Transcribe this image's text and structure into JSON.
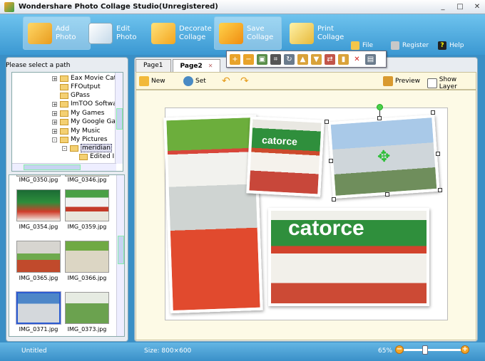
{
  "window": {
    "title": "Wondershare Photo Collage Studio(Unregistered)",
    "min": "_",
    "max": "□",
    "close": "✕"
  },
  "toolbar": {
    "add_photo": "Add Photo",
    "edit_photo": "Edit Photo",
    "decorate_collage": "Decorate Collage",
    "save_collage": "Save Collage",
    "print_collage": "Print Collage",
    "file": "File",
    "register": "Register",
    "help": "Help"
  },
  "left": {
    "path_label": "Please select a path",
    "tree": [
      {
        "label": "Eax Movie Catalog",
        "pm": "+"
      },
      {
        "label": "FFOutput",
        "pm": ""
      },
      {
        "label": "GPass",
        "pm": ""
      },
      {
        "label": "ImTOO Software",
        "pm": "+"
      },
      {
        "label": "My Games",
        "pm": "+"
      },
      {
        "label": "My Google Gadgets",
        "pm": "+"
      },
      {
        "label": "My Music",
        "pm": "+"
      },
      {
        "label": "My Pictures",
        "pm": "-"
      },
      {
        "label": "meridian",
        "pm": "-"
      },
      {
        "label": "Edited Im",
        "pm": ""
      }
    ],
    "thumbs": [
      {
        "caption": "IMG_0350.jpg"
      },
      {
        "caption": "IMG_0346.jpg"
      },
      {
        "caption": "IMG_0354.jpg"
      },
      {
        "caption": "IMG_0359.jpg"
      },
      {
        "caption": "IMG_0365.jpg"
      },
      {
        "caption": "IMG_0366.jpg"
      },
      {
        "caption": "IMG_0371.jpg"
      },
      {
        "caption": "IMG_0373.jpg"
      }
    ]
  },
  "tabs": {
    "page1": "Page1",
    "page2": "Page2",
    "close": "✕"
  },
  "main_tools": {
    "new": "New",
    "set": "Set",
    "preview": "Preview",
    "show_layer": "Show Layer"
  },
  "photos": {
    "sign_text_1": "catorce",
    "sign_text_2": "catorce"
  },
  "status": {
    "left": "Untitled",
    "size": "Size:  800×600",
    "zoom": "65%",
    "zoom_level": 0.36,
    "zoom_minus": "−",
    "zoom_plus": "+"
  }
}
